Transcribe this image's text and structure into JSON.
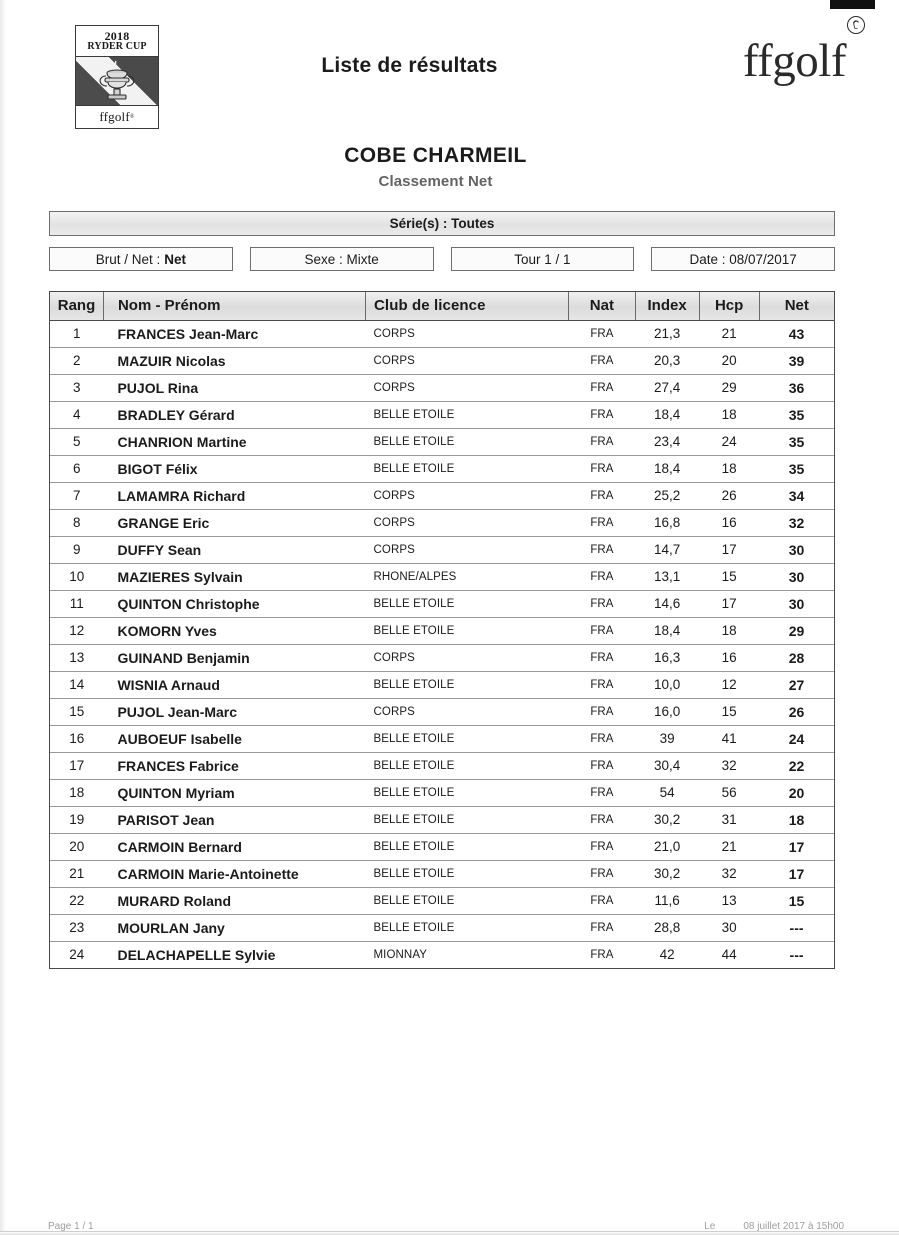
{
  "document": {
    "title": "Liste de résultats"
  },
  "logo_left": {
    "year": "2018",
    "event": "RYDER CUP",
    "federation": "ffgolf",
    "registered_mark": "®",
    "icon": "ryder-cup-trophy-icon"
  },
  "logo_right": {
    "wordmark": "ffgolf",
    "registered_mark": "®",
    "icon": "rooster-icon"
  },
  "event": {
    "name": "COBE CHARMEIL",
    "classification": "Classement Net"
  },
  "series": {
    "label": "Série(s) : Toutes"
  },
  "filters": [
    {
      "label": "Brut / Net :",
      "value": "Net"
    },
    {
      "label": "Sexe :",
      "value": "Mixte"
    },
    {
      "label": "Tour 1 / 1",
      "value": ""
    },
    {
      "label": "Date : 08/07/2017",
      "value": ""
    }
  ],
  "table": {
    "columns": [
      "Rang",
      "Nom - Prénom",
      "Club de licence",
      "Nat",
      "Index",
      "Hcp",
      "Net"
    ],
    "rows": [
      {
        "rang": "1",
        "nom": "FRANCES Jean-Marc",
        "club": "CORPS",
        "nat": "FRA",
        "index": "21,3",
        "hcp": "21",
        "net": "43"
      },
      {
        "rang": "2",
        "nom": "MAZUIR Nicolas",
        "club": "CORPS",
        "nat": "FRA",
        "index": "20,3",
        "hcp": "20",
        "net": "39"
      },
      {
        "rang": "3",
        "nom": "PUJOL Rina",
        "club": "CORPS",
        "nat": "FRA",
        "index": "27,4",
        "hcp": "29",
        "net": "36"
      },
      {
        "rang": "4",
        "nom": "BRADLEY Gérard",
        "club": "BELLE ETOILE",
        "nat": "FRA",
        "index": "18,4",
        "hcp": "18",
        "net": "35"
      },
      {
        "rang": "5",
        "nom": "CHANRION Martine",
        "club": "BELLE ETOILE",
        "nat": "FRA",
        "index": "23,4",
        "hcp": "24",
        "net": "35"
      },
      {
        "rang": "6",
        "nom": "BIGOT Félix",
        "club": "BELLE ETOILE",
        "nat": "FRA",
        "index": "18,4",
        "hcp": "18",
        "net": "35"
      },
      {
        "rang": "7",
        "nom": "LAMAMRA Richard",
        "club": "CORPS",
        "nat": "FRA",
        "index": "25,2",
        "hcp": "26",
        "net": "34"
      },
      {
        "rang": "8",
        "nom": "GRANGE Eric",
        "club": "CORPS",
        "nat": "FRA",
        "index": "16,8",
        "hcp": "16",
        "net": "32"
      },
      {
        "rang": "9",
        "nom": "DUFFY Sean",
        "club": "CORPS",
        "nat": "FRA",
        "index": "14,7",
        "hcp": "17",
        "net": "30"
      },
      {
        "rang": "10",
        "nom": "MAZIERES Sylvain",
        "club": "RHONE/ALPES",
        "nat": "FRA",
        "index": "13,1",
        "hcp": "15",
        "net": "30"
      },
      {
        "rang": "11",
        "nom": "QUINTON Christophe",
        "club": "BELLE ETOILE",
        "nat": "FRA",
        "index": "14,6",
        "hcp": "17",
        "net": "30"
      },
      {
        "rang": "12",
        "nom": "KOMORN Yves",
        "club": "BELLE ETOILE",
        "nat": "FRA",
        "index": "18,4",
        "hcp": "18",
        "net": "29"
      },
      {
        "rang": "13",
        "nom": "GUINAND Benjamin",
        "club": "CORPS",
        "nat": "FRA",
        "index": "16,3",
        "hcp": "16",
        "net": "28"
      },
      {
        "rang": "14",
        "nom": "WISNIA Arnaud",
        "club": "BELLE ETOILE",
        "nat": "FRA",
        "index": "10,0",
        "hcp": "12",
        "net": "27"
      },
      {
        "rang": "15",
        "nom": "PUJOL Jean-Marc",
        "club": "CORPS",
        "nat": "FRA",
        "index": "16,0",
        "hcp": "15",
        "net": "26"
      },
      {
        "rang": "16",
        "nom": "AUBOEUF Isabelle",
        "club": "BELLE ETOILE",
        "nat": "FRA",
        "index": "39",
        "hcp": "41",
        "net": "24"
      },
      {
        "rang": "17",
        "nom": "FRANCES Fabrice",
        "club": "BELLE ETOILE",
        "nat": "FRA",
        "index": "30,4",
        "hcp": "32",
        "net": "22"
      },
      {
        "rang": "18",
        "nom": "QUINTON Myriam",
        "club": "BELLE ETOILE",
        "nat": "FRA",
        "index": "54",
        "hcp": "56",
        "net": "20"
      },
      {
        "rang": "19",
        "nom": "PARISOT Jean",
        "club": "BELLE ETOILE",
        "nat": "FRA",
        "index": "30,2",
        "hcp": "31",
        "net": "18"
      },
      {
        "rang": "20",
        "nom": "CARMOIN Bernard",
        "club": "BELLE ETOILE",
        "nat": "FRA",
        "index": "21,0",
        "hcp": "21",
        "net": "17"
      },
      {
        "rang": "21",
        "nom": "CARMOIN Marie-Antoinette",
        "club": "BELLE ETOILE",
        "nat": "FRA",
        "index": "30,2",
        "hcp": "32",
        "net": "17"
      },
      {
        "rang": "22",
        "nom": "MURARD Roland",
        "club": "BELLE ETOILE",
        "nat": "FRA",
        "index": "11,6",
        "hcp": "13",
        "net": "15"
      },
      {
        "rang": "23",
        "nom": "MOURLAN Jany",
        "club": "BELLE ETOILE",
        "nat": "FRA",
        "index": "28,8",
        "hcp": "30",
        "net": "---"
      },
      {
        "rang": "24",
        "nom": "DELACHAPELLE Sylvie",
        "club": "MIONNAY",
        "nat": "FRA",
        "index": "42",
        "hcp": "44",
        "net": "---"
      }
    ]
  },
  "footer": {
    "page": "Page 1 / 1",
    "generated_prefix": "Le",
    "generated": "08 juillet 2017 à 15h00"
  },
  "colors": {
    "text": "#1b1b1b",
    "muted": "#636363",
    "border": "#4a4a4a",
    "header_fill": "#dcdcdc",
    "paper": "#ffffff"
  }
}
